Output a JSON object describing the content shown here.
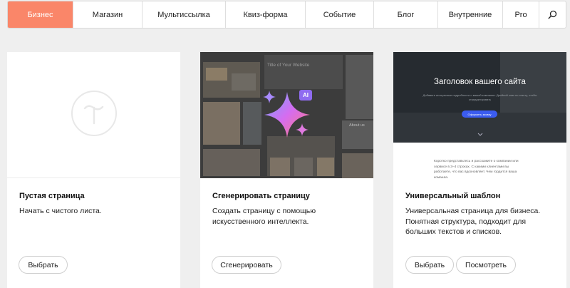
{
  "tabs": [
    {
      "label": "Бизнес",
      "active": true
    },
    {
      "label": "Магазин",
      "active": false
    },
    {
      "label": "Мультиссылка",
      "active": false
    },
    {
      "label": "Квиз-форма",
      "active": false
    },
    {
      "label": "Событие",
      "active": false
    },
    {
      "label": "Блог",
      "active": false
    },
    {
      "label": "Внутренние",
      "active": false
    },
    {
      "label": "Pro",
      "active": false
    }
  ],
  "search_icon": "search-icon",
  "colors": {
    "accent": "#fa8669",
    "background": "#efefef",
    "card": "#ffffff"
  },
  "cards": [
    {
      "title": "Пустая страница",
      "description": "Начать с чистого листа.",
      "buttons": [
        "Выбрать"
      ],
      "preview_icon": "tilda-logo-icon"
    },
    {
      "title": "Сгенерировать страницу",
      "description": "Создать страницу с помощью искусственного интеллекта.",
      "buttons": [
        "Сгенерировать"
      ],
      "preview_icon": "ai-sparkle-icon",
      "preview": {
        "site_title": "Title of Your Website",
        "badge": "AI",
        "about": "About us"
      }
    },
    {
      "title": "Универсальный шаблон",
      "description": "Универсальная страница для бизнеса. Понятная структура, подходит для больших текстов и списков.",
      "buttons": [
        "Выбрать",
        "Посмотреть"
      ],
      "preview": {
        "heading": "Заголовок вашего сайта",
        "subheading": "Добавьте интересные подробности о вашей компании. Двойной клик по тексту, чтобы отредактировать",
        "cta": "Оформить заявку",
        "body": "Коротко представьтесь и расскажите о компании или сервисе в 3–4 строках. С какими клиентами вы работаете, что вас вдохновляет. Чем гордится ваша команда."
      }
    }
  ]
}
